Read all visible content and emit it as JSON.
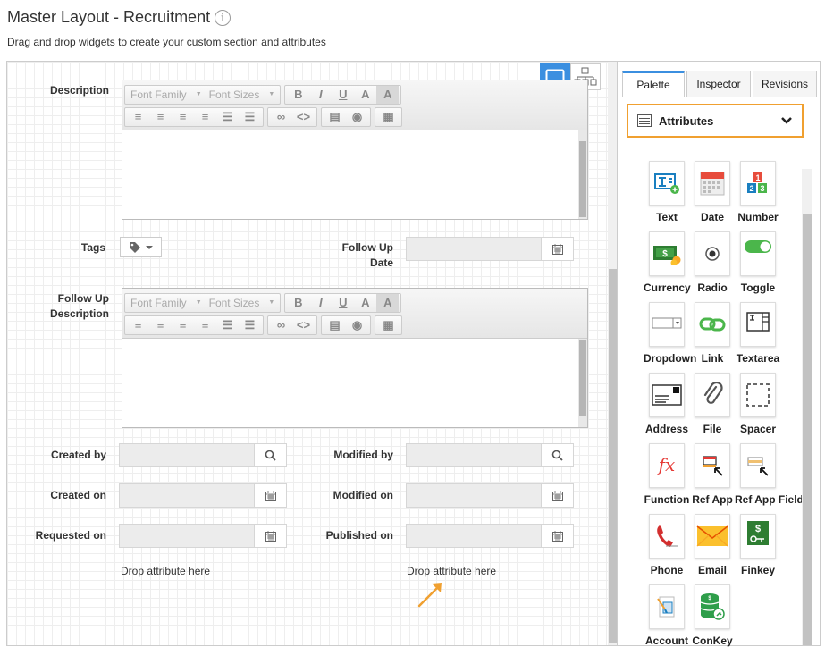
{
  "header": {
    "title": "Master Layout - Recruitment",
    "info_icon": "info-icon",
    "subtitle": "Drag and drop widgets to create your custom section and attributes"
  },
  "canvas": {
    "view_toggle": [
      "desktop-icon",
      "hierarchy-icon"
    ],
    "fields": {
      "description_label": "Description",
      "tags_label": "Tags",
      "follow_up_date_label": "Follow Up Date",
      "follow_up_description_label": "Follow Up Description",
      "created_by_label": "Created by",
      "modified_by_label": "Modified by",
      "created_on_label": "Created on",
      "modified_on_label": "Modified on",
      "requested_on_label": "Requested on",
      "published_on_label": "Published on"
    },
    "editor": {
      "font_family": "Font Family",
      "font_sizes": "Font Sizes"
    },
    "drop_hint_left": "Drop attribute here",
    "drop_hint_right": "Drop attribute here"
  },
  "sidebar": {
    "tabs": [
      "Palette",
      "Inspector",
      "Revisions"
    ],
    "active_tab": "Palette",
    "accordion_title": "Attributes",
    "widgets": [
      {
        "label": "Text",
        "icon": "text-widget-icon"
      },
      {
        "label": "Date",
        "icon": "calendar-icon"
      },
      {
        "label": "Number",
        "icon": "number-icon"
      },
      {
        "label": "Currency",
        "icon": "currency-icon"
      },
      {
        "label": "Radio",
        "icon": "radio-icon"
      },
      {
        "label": "Toggle",
        "icon": "toggle-icon"
      },
      {
        "label": "Dropdown",
        "icon": "dropdown-icon"
      },
      {
        "label": "Link",
        "icon": "link-icon"
      },
      {
        "label": "Textarea",
        "icon": "textarea-icon"
      },
      {
        "label": "Address",
        "icon": "address-icon"
      },
      {
        "label": "File",
        "icon": "paperclip-icon"
      },
      {
        "label": "Spacer",
        "icon": "spacer-icon"
      },
      {
        "label": "Function",
        "icon": "function-icon"
      },
      {
        "label": "Ref App",
        "icon": "ref-app-icon"
      },
      {
        "label": "Ref App Field",
        "icon": "ref-app-field-icon"
      },
      {
        "label": "Phone",
        "icon": "phone-icon"
      },
      {
        "label": "Email",
        "icon": "email-icon"
      },
      {
        "label": "Finkey",
        "icon": "finkey-icon"
      },
      {
        "label": "Account",
        "icon": "account-icon"
      },
      {
        "label": "ConKey",
        "icon": "conkey-icon"
      }
    ]
  },
  "colors": {
    "accent_blue": "#3b8fe0",
    "highlight_orange": "#f0a030"
  }
}
